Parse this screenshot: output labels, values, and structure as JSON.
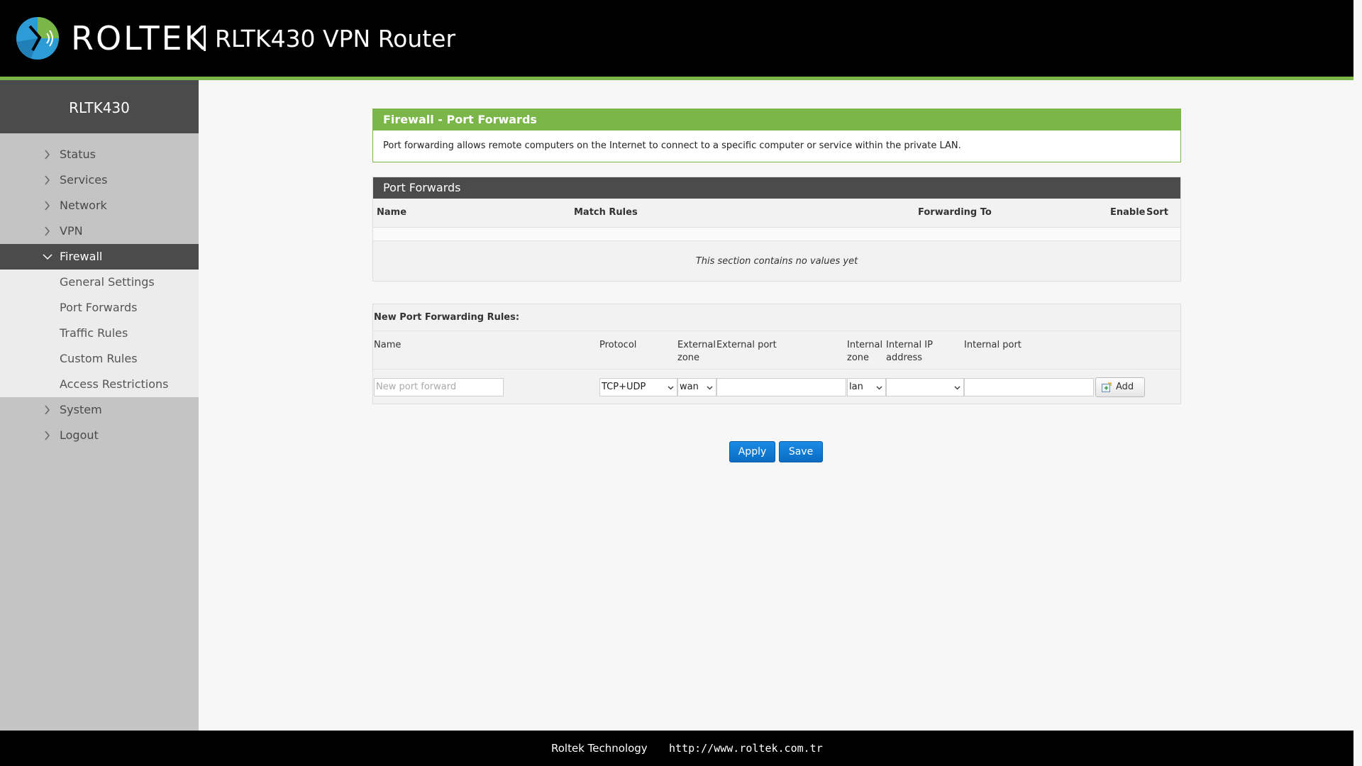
{
  "header": {
    "brand": "ROLTEK",
    "product": "RLTK430 VPN Router",
    "colors": {
      "accent": "#7ab648",
      "header_bg": "#000000",
      "logo_blue": "#2d9bd6"
    }
  },
  "sidebar": {
    "title": "RLTK430",
    "items": [
      {
        "label": "Status"
      },
      {
        "label": "Services"
      },
      {
        "label": "Network"
      },
      {
        "label": "VPN"
      },
      {
        "label": "Firewall",
        "expanded": true,
        "active": true
      },
      {
        "label": "System"
      },
      {
        "label": "Logout"
      }
    ],
    "firewall_subitems": [
      {
        "label": "General Settings"
      },
      {
        "label": "Port Forwards"
      },
      {
        "label": "Traffic Rules"
      },
      {
        "label": "Custom Rules"
      },
      {
        "label": "Access Restrictions"
      }
    ]
  },
  "main": {
    "section_title": "Firewall - Port Forwards",
    "section_desc": "Port forwarding allows remote computers on the Internet to connect to a specific computer or service within the private LAN.",
    "table": {
      "title": "Port Forwards",
      "columns": [
        "Name",
        "Match Rules",
        "Forwarding To",
        "Enable",
        "Sort"
      ],
      "empty_text": "This section contains no values yet"
    },
    "new_rules": {
      "title": "New Port Forwarding Rules:",
      "columns": {
        "name": "Name",
        "protocol": "Protocol",
        "external_zone": "External zone",
        "external_port": "External port",
        "internal_zone": "Internal zone",
        "internal_ip": "Internal IP address",
        "internal_port": "Internal port"
      },
      "inputs": {
        "name_placeholder": "New port forward",
        "protocol": "TCP+UDP",
        "external_zone": "wan",
        "external_port": "",
        "internal_zone": "lan",
        "internal_ip": "",
        "internal_port": ""
      },
      "add_label": "Add"
    },
    "buttons": {
      "apply": "Apply",
      "save": "Save"
    }
  },
  "footer": {
    "company": "Roltek Technology",
    "url": "http://www.roltek.com.tr"
  }
}
